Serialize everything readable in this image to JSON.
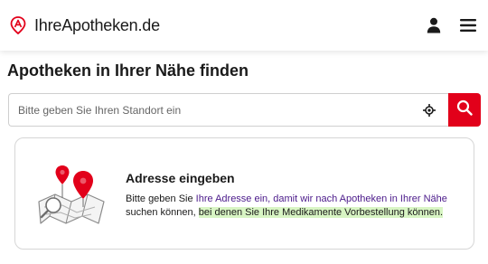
{
  "header": {
    "brand": "IhreApotheken.de",
    "logo_icon": "pharmacy-pin-logo-icon",
    "user_icon": "user-icon",
    "menu_icon": "hamburger-menu-icon",
    "accent_color": "#e2001a"
  },
  "page": {
    "title": "Apotheken in Ihrer Nähe finden"
  },
  "search": {
    "placeholder": "Bitte geben Sie Ihren Standort ein",
    "value": "",
    "locate_icon": "crosshair-location-icon",
    "search_icon": "search-icon"
  },
  "info_card": {
    "illustration": "map-pins-illustration",
    "title": "Adresse eingeben",
    "text_part1": "Bitte geben Sie ",
    "text_part2": "Ihre Adresse ein, damit wir nach Apotheken in Ihrer Nähe",
    "text_part3": " suchen können, ",
    "text_part4": "bei denen Sie Ihre Medikamente Vorbestellung können."
  }
}
